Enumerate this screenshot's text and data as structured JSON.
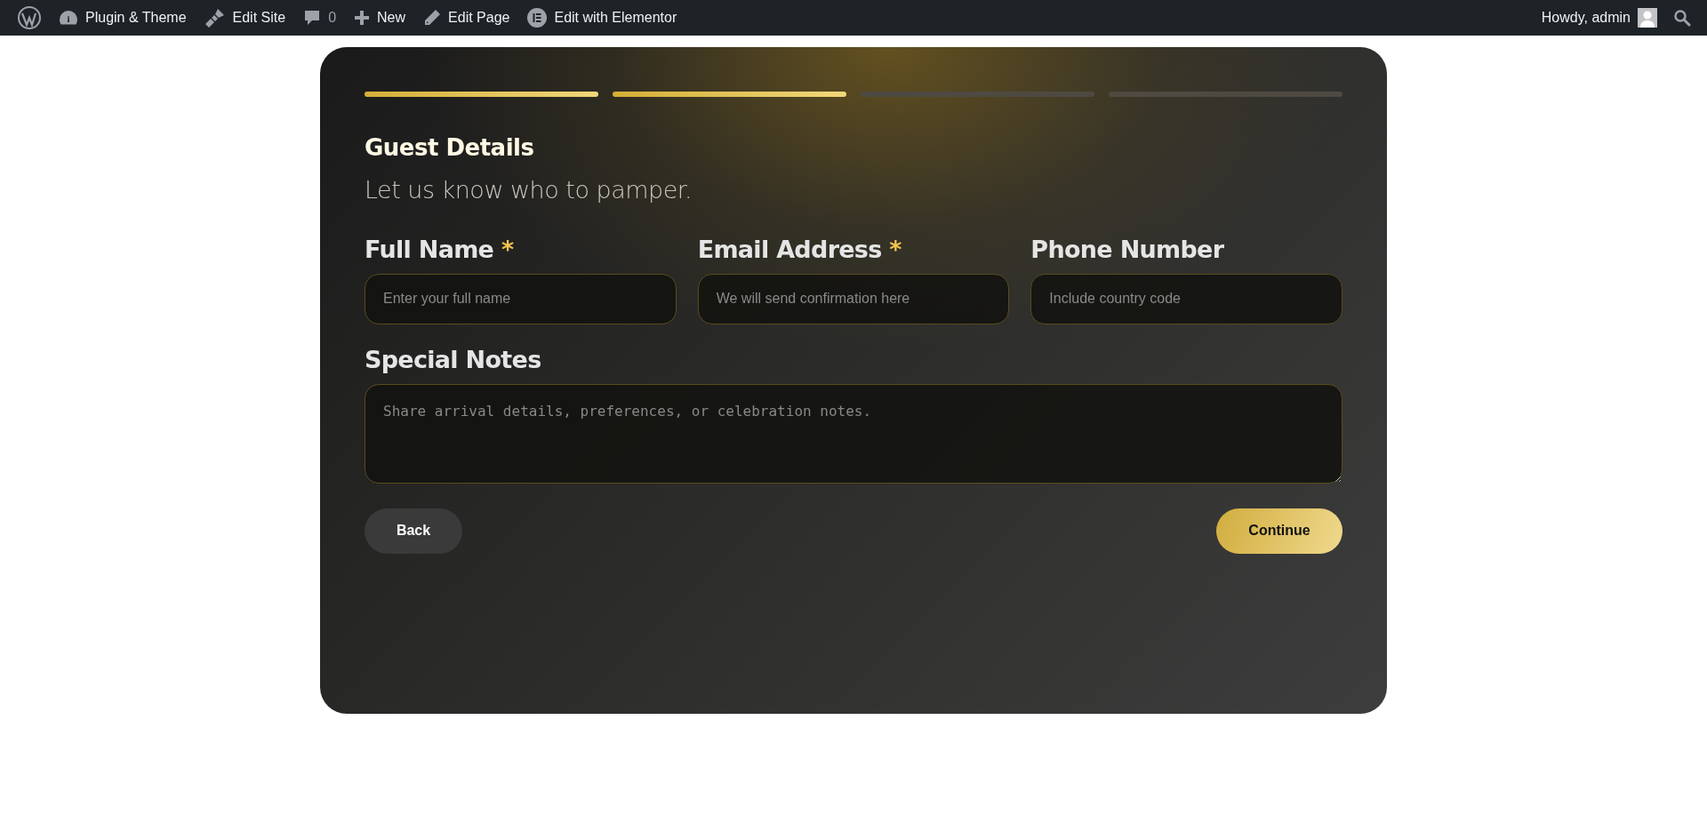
{
  "admin_bar": {
    "left": [
      {
        "kind": "wordpress"
      },
      {
        "kind": "dashboard",
        "label": "Plugin & Theme"
      },
      {
        "kind": "brush",
        "label": "Edit Site"
      },
      {
        "kind": "comment",
        "label": "0"
      },
      {
        "kind": "plus",
        "label": "New"
      },
      {
        "kind": "pencil",
        "label": "Edit Page"
      },
      {
        "kind": "elementor",
        "label": "Edit with Elementor"
      }
    ],
    "greeting": "Howdy, admin"
  },
  "form": {
    "steps": [
      {
        "completed": true
      },
      {
        "completed": true
      },
      {
        "completed": false
      },
      {
        "completed": false
      }
    ],
    "title": "Guest Details",
    "subtitle": "Let us know who to pamper.",
    "fields": [
      {
        "label": "Full Name",
        "marker": "*",
        "placeholder": "Enter your full name"
      },
      {
        "label": "Email Address",
        "marker": "*",
        "placeholder": "We will send confirmation here"
      },
      {
        "label": "Phone Number",
        "placeholder": "Include country code"
      }
    ],
    "notes": {
      "label": "Special Notes",
      "placeholder": "Share arrival details, preferences, or celebration notes."
    },
    "buttons": [
      {
        "kind": "back",
        "label": "Back"
      },
      {
        "kind": "continue",
        "label": "Continue"
      }
    ]
  }
}
